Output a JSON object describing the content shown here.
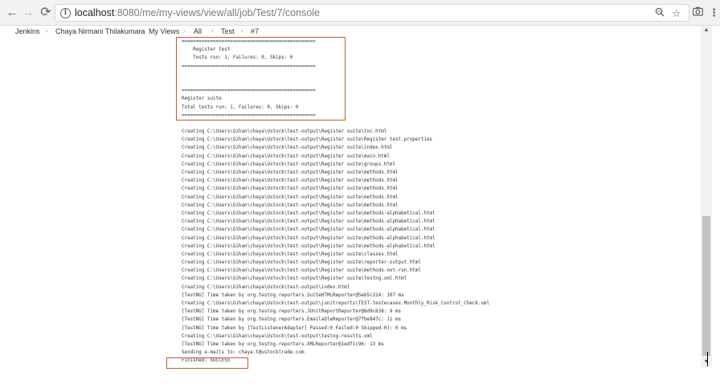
{
  "browser": {
    "url_host": "localhost",
    "url_path": ":8080/me/my-views/view/all/job/Test/7/console",
    "icons": [
      "back-arrow-icon",
      "forward-arrow-icon",
      "reload-icon",
      "info-icon",
      "zoom-icon",
      "star-icon",
      "camera-icon",
      "menu-dots-icon"
    ]
  },
  "breadcrumb": {
    "items": [
      "Jenkins",
      "Chaya Nirmani Thilakumara",
      "My Views",
      "All",
      "Test",
      "#7"
    ],
    "separator": "›"
  },
  "console": {
    "lines": [
      "===============================================",
      "    Register test",
      "    Tests run: 1, Failures: 0, Skips: 0",
      "===============================================",
      "",
      "",
      "===============================================",
      "Register suite",
      "Total tests run: 1, Failures: 0, Skips: 0",
      "===============================================",
      "",
      "Creating C:\\Users\\Gihan\\chaya\\Ustock\\test-output\\Register suite\\toc.html",
      "Creating C:\\Users\\Gihan\\chaya\\Ustock\\test-output\\Register suite\\Register test.properties",
      "Creating C:\\Users\\Gihan\\chaya\\Ustock\\test-output\\Register suite\\index.html",
      "Creating C:\\Users\\Gihan\\chaya\\Ustock\\test-output\\Register suite\\main.html",
      "Creating C:\\Users\\Gihan\\chaya\\Ustock\\test-output\\Register suite\\groups.html",
      "Creating C:\\Users\\Gihan\\chaya\\Ustock\\test-output\\Register suite\\methods.html",
      "Creating C:\\Users\\Gihan\\chaya\\Ustock\\test-output\\Register suite\\methods.html",
      "Creating C:\\Users\\Gihan\\chaya\\Ustock\\test-output\\Register suite\\methods.html",
      "Creating C:\\Users\\Gihan\\chaya\\Ustock\\test-output\\Register suite\\methods.html",
      "Creating C:\\Users\\Gihan\\chaya\\Ustock\\test-output\\Register suite\\methods.html",
      "Creating C:\\Users\\Gihan\\chaya\\Ustock\\test-output\\Register suite\\methods-alphabetical.html",
      "Creating C:\\Users\\Gihan\\chaya\\Ustock\\test-output\\Register suite\\methods-alphabetical.html",
      "Creating C:\\Users\\Gihan\\chaya\\Ustock\\test-output\\Register suite\\methods-alphabetical.html",
      "Creating C:\\Users\\Gihan\\chaya\\Ustock\\test-output\\Register suite\\methods-alphabetical.html",
      "Creating C:\\Users\\Gihan\\chaya\\Ustock\\test-output\\Register suite\\methods-alphabetical.html",
      "Creating C:\\Users\\Gihan\\chaya\\Ustock\\test-output\\Register suite\\classes.html",
      "Creating C:\\Users\\Gihan\\chaya\\Ustock\\test-output\\Register suite\\reporter-output.html",
      "Creating C:\\Users\\Gihan\\chaya\\Ustock\\test-output\\Register suite\\methods-not-run.html",
      "Creating C:\\Users\\Gihan\\chaya\\Ustock\\test-output\\Register suite\\testng.xml.html",
      "Creating C:\\Users\\Gihan\\chaya\\Ustock\\test-output\\index.html",
      "[TestNG] Time taken by org.testng.reporters.SuiteHTMLReporter@5eb5c224: 107 ms",
      "Creating C:\\Users\\Gihan\\chaya\\Ustock\\test-output\\junitreports\\TEST-testecases.Monthly_Risk_Control_Check.xml",
      "[TestNG] Time taken by org.testng.reporters.JUnitReportReporter@6d9c638: 9 ms",
      "[TestNG] Time taken by org.testng.reporters.EmailableReporter@7fbe847c: 11 ms",
      "[TestNG] Time taken by [TestListenerAdapter] Passed:0 Failed:0 Skipped:0]: 0 ms",
      "Creating C:\\Users\\Gihan\\chaya\\Ustock\\test-output\\testng-results.xml",
      "[TestNG] Time taken by org.testng.reporters.XMLReporter@1edf1c96: 13 ms",
      "Sending e-mails to: chaya.t@ustocktrade.com",
      "Finished: SUCCESS"
    ]
  },
  "colors": {
    "highlight_border": "#c8592b",
    "console_text": "#333333"
  }
}
